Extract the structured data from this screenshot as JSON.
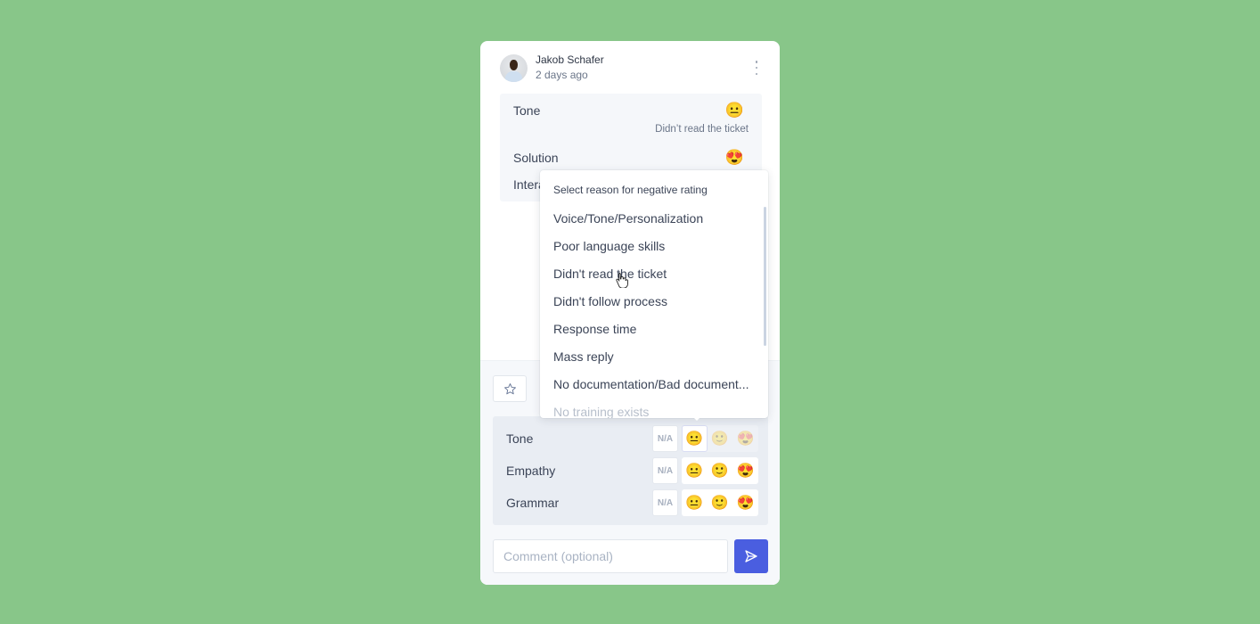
{
  "review": {
    "author": "Jakob Schafer",
    "time": "2 days ago"
  },
  "summary": {
    "rows": [
      {
        "label": "Tone",
        "emoji": "😐",
        "reason": "Didn’t read the ticket"
      },
      {
        "label": "Solution",
        "emoji": "😍"
      },
      {
        "label": "Interaction",
        "emoji": ""
      }
    ]
  },
  "dropdown": {
    "title": "Select reason for negative rating",
    "items": [
      "Voice/Tone/Personalization",
      "Poor language skills",
      "Didn't read the ticket",
      "Didn't follow process",
      "Response time",
      "Mass reply",
      "No documentation/Bad document...",
      "No training exists"
    ],
    "hovered": "Didn't read the ticket"
  },
  "rating": {
    "na_label": "N/A",
    "faces": [
      "😐",
      "🙂",
      "😍"
    ],
    "rows": [
      {
        "label": "Tone",
        "selected": "😐"
      },
      {
        "label": "Empathy",
        "selected": null
      },
      {
        "label": "Grammar",
        "selected": null
      }
    ]
  },
  "comment": {
    "placeholder": "Comment (optional)",
    "value": ""
  },
  "colors": {
    "background": "#88c689",
    "send_button": "#4a5ee0"
  }
}
